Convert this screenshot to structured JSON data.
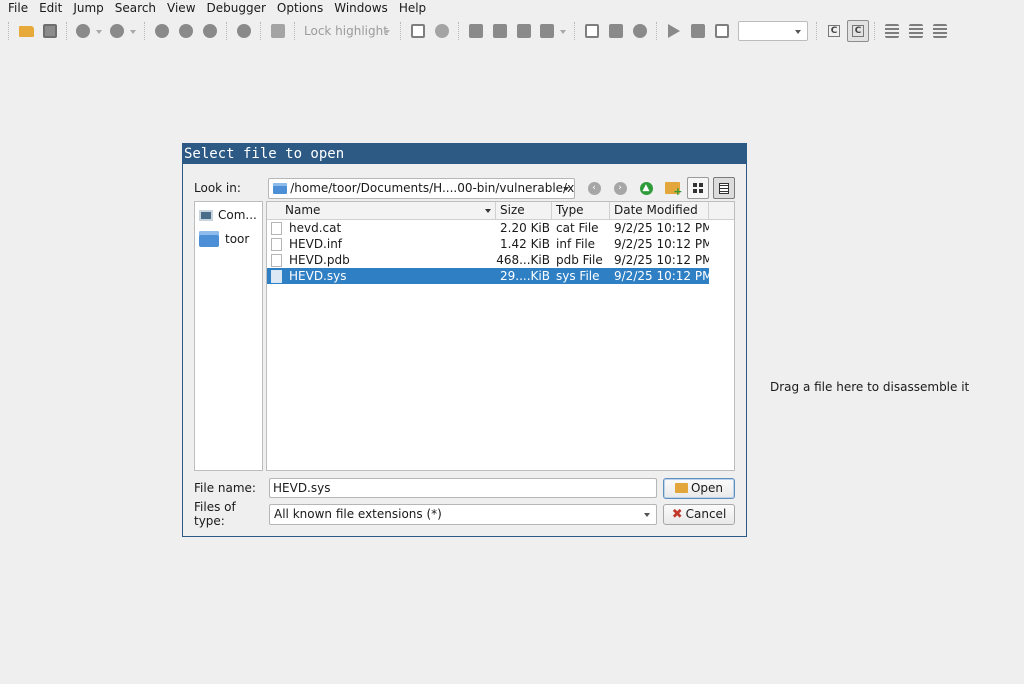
{
  "menubar": {
    "items": [
      {
        "label": "File"
      },
      {
        "label": "Edit"
      },
      {
        "label": "Jump"
      },
      {
        "label": "Search"
      },
      {
        "label": "View"
      },
      {
        "label": "Debugger"
      },
      {
        "label": "Options"
      },
      {
        "label": "Windows"
      },
      {
        "label": "Help"
      }
    ]
  },
  "toolbar": {
    "lock_highlight": "Lock highlight"
  },
  "drop_hint": "Drag a file here to disassemble it",
  "dialog": {
    "title": "Select file to open",
    "look_in_label": "Look in:",
    "look_in_path": "/home/toor/Documents/H....00-bin/vulnerable/x64",
    "sidebar": [
      {
        "label": "Com...",
        "icon": "computer-icon"
      },
      {
        "label": "toor",
        "icon": "folder-icon"
      }
    ],
    "columns": {
      "name": "Name",
      "size": "Size",
      "type": "Type",
      "date": "Date Modified"
    },
    "files": [
      {
        "name": "hevd.cat",
        "size": "2.20 KiB",
        "type": "cat File",
        "date": "9/2/25 10:12 PM"
      },
      {
        "name": "HEVD.inf",
        "size": "1.42 KiB",
        "type": "inf File",
        "date": "9/2/25 10:12 PM"
      },
      {
        "name": "HEVD.pdb",
        "size": "468...KiB",
        "type": "pdb File",
        "date": "9/2/25 10:12 PM"
      },
      {
        "name": "HEVD.sys",
        "size": "29....KiB",
        "type": "sys File",
        "date": "9/2/25 10:12 PM"
      }
    ],
    "file_name_label": "File name:",
    "file_name_value": "HEVD.sys",
    "files_of_type_label": "Files of type:",
    "files_of_type_value": "All known file extensions (*)",
    "open_label": "Open",
    "cancel_label": "Cancel"
  }
}
